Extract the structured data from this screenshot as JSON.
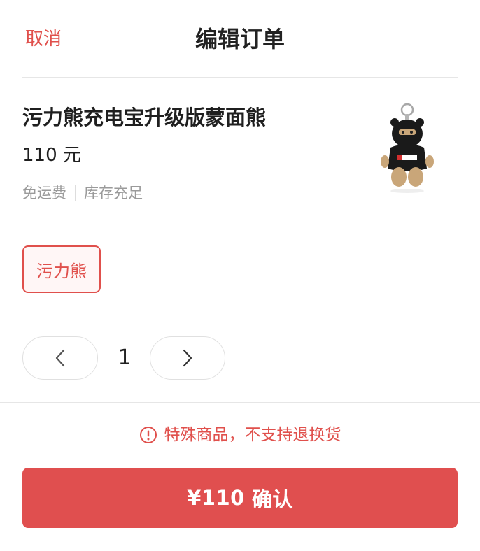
{
  "header": {
    "cancel_label": "取消",
    "title": "编辑订单"
  },
  "product": {
    "name": "污力熊充电宝升级版蒙面熊",
    "price": "110 元",
    "tags": [
      "免运费",
      "库存充足"
    ],
    "image_icon": "bear-keychain-image"
  },
  "variant": {
    "selected_label": "污力熊"
  },
  "quantity": {
    "value": "1",
    "decrease_icon": "chevron-left-icon",
    "increase_icon": "chevron-right-icon"
  },
  "notice": {
    "text": "特殊商品，不支持退换货",
    "icon": "exclamation-circle-icon"
  },
  "confirm": {
    "amount_label": "¥110",
    "action_label": "确认"
  },
  "colors": {
    "accent": "#e0504c",
    "button_bg": "#e04f4f",
    "muted_text": "#9a9a9a"
  }
}
